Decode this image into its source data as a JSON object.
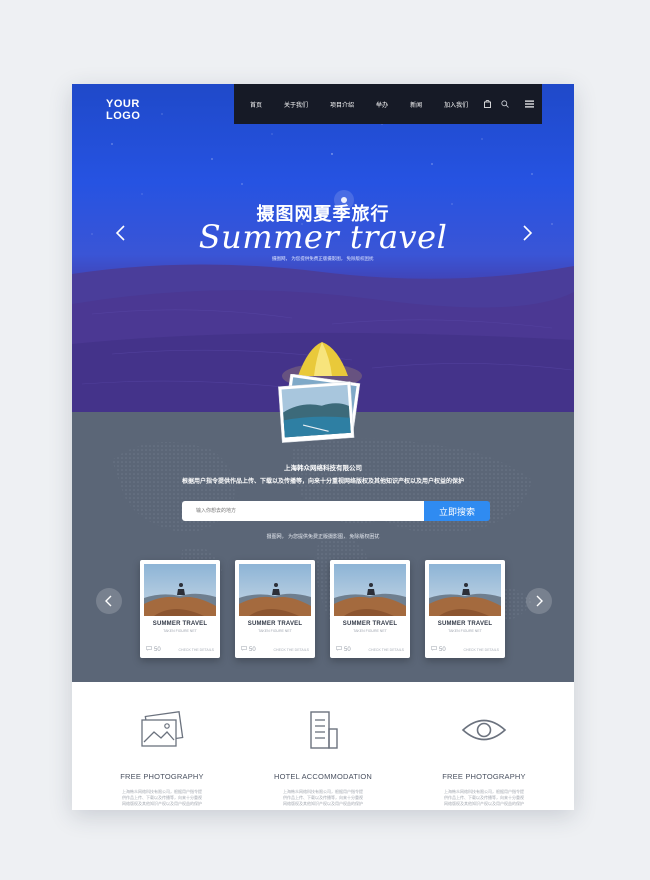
{
  "logo": {
    "line1": "YOUR",
    "line2": "LOGO"
  },
  "nav": {
    "items": [
      "首页",
      "关于我们",
      "项目介绍",
      "举办",
      "新闻",
      "加入我们"
    ],
    "icons": [
      "bag-icon",
      "search-icon",
      "menu-icon"
    ]
  },
  "hero": {
    "title_cn": "摄图网夏季旅行",
    "title_en": "Summer travel",
    "subtitle": "摄图网，  为您提供免费正版摄影图，  免除版权困扰",
    "arrows": [
      "chevron-left-icon",
      "chevron-right-icon"
    ]
  },
  "info": {
    "company": "上海韩众网络科技有限公司",
    "description": "根据用户指令提供作品上传、下载以及传播等，向来十分重视网络版权及其他知识产权以及用户权益的保护"
  },
  "search": {
    "placeholder": "输入你想去的地方",
    "button": "立即搜索",
    "note": "摄图网，  为您提供免费正版摄影图，  免除版权困扰"
  },
  "cards": [
    {
      "title": "SUMMER TRAVEL",
      "subtitle": "TAKEN FIGURE NET",
      "count": "50",
      "link": "CHECK THE DETAILS"
    },
    {
      "title": "SUMMER TRAVEL",
      "subtitle": "TAKEN FIGURE NET",
      "count": "50",
      "link": "CHECK THE DETAILS"
    },
    {
      "title": "SUMMER TRAVEL",
      "subtitle": "TAKEN FIGURE NET",
      "count": "50",
      "link": "CHECK THE DETAILS"
    },
    {
      "title": "SUMMER TRAVEL",
      "subtitle": "TAKEN FIGURE NET",
      "count": "50",
      "link": "CHECK THE DETAILS"
    }
  ],
  "features": [
    {
      "icon": "photo-icon",
      "title": "FREE PHOTOGRAPHY",
      "text": "上海韩众网络科技有限公司，根据用户指令提供作品上传、下载以及传播等，向来十分重视网络版权及其他知识产权以及用户权益的保护"
    },
    {
      "icon": "building-icon",
      "title": "HOTEL ACCOMMODATION",
      "text": "上海韩众网络科技有限公司，根据用户指令提供作品上传、下载以及传播等，向来十分重视网络版权及其他知识产权以及用户权益的保护"
    },
    {
      "icon": "eye-icon",
      "title": "FREE PHOTOGRAPHY",
      "text": "上海韩众网络科技有限公司，根据用户指令提供作品上传、下载以及传播等，向来十分重视网络版权及其他知识产权以及用户权益的保护"
    }
  ],
  "colors": {
    "nav_bg": "#161a26",
    "accent": "#2f8bf1",
    "section_bg": "#5b6677",
    "hero_top": "#1f49c9",
    "dune": "#4b3894"
  }
}
